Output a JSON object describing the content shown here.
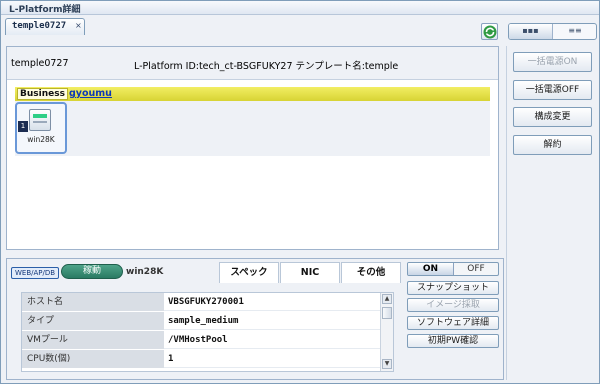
{
  "window": {
    "title": "L-Platform詳細"
  },
  "tab": {
    "label": "temple0727",
    "close": "×"
  },
  "view_toggle": {
    "left": "▪▪▪",
    "right": "≡≡"
  },
  "main": {
    "platform_name": "temple0727",
    "platform_info": "L-Platform ID:tech_ct-BSGFUKY27  テンプレート名:temple",
    "business_label": "Business",
    "business_link": "gyoumu",
    "server": {
      "index": "1",
      "name": "win28K"
    }
  },
  "side_buttons": [
    "一括電源ON",
    "一括電源OFF",
    "構成変更",
    "解約"
  ],
  "detail": {
    "env_tag": "WEB/AP/DB",
    "status": "稼動",
    "host_name": "win28K",
    "tabs": [
      "スペック",
      "NIC",
      "その他"
    ],
    "power": {
      "on": "ON",
      "off": "OFF"
    },
    "actions": [
      "スナップショット",
      "イメージ採取",
      "ソフトウェア詳細",
      "初期PW確認"
    ],
    "spec": [
      {
        "key": "ホスト名",
        "value": "VBSGFUKY270001"
      },
      {
        "key": "タイプ",
        "value": "sample_medium"
      },
      {
        "key": "VMプール",
        "value": "/VMHostPool"
      },
      {
        "key": "CPU数(個)",
        "value": "1"
      }
    ]
  },
  "colors": {
    "business_bar": "#e3df42",
    "status": "#2f8a6e",
    "link": "#0b38b8"
  }
}
